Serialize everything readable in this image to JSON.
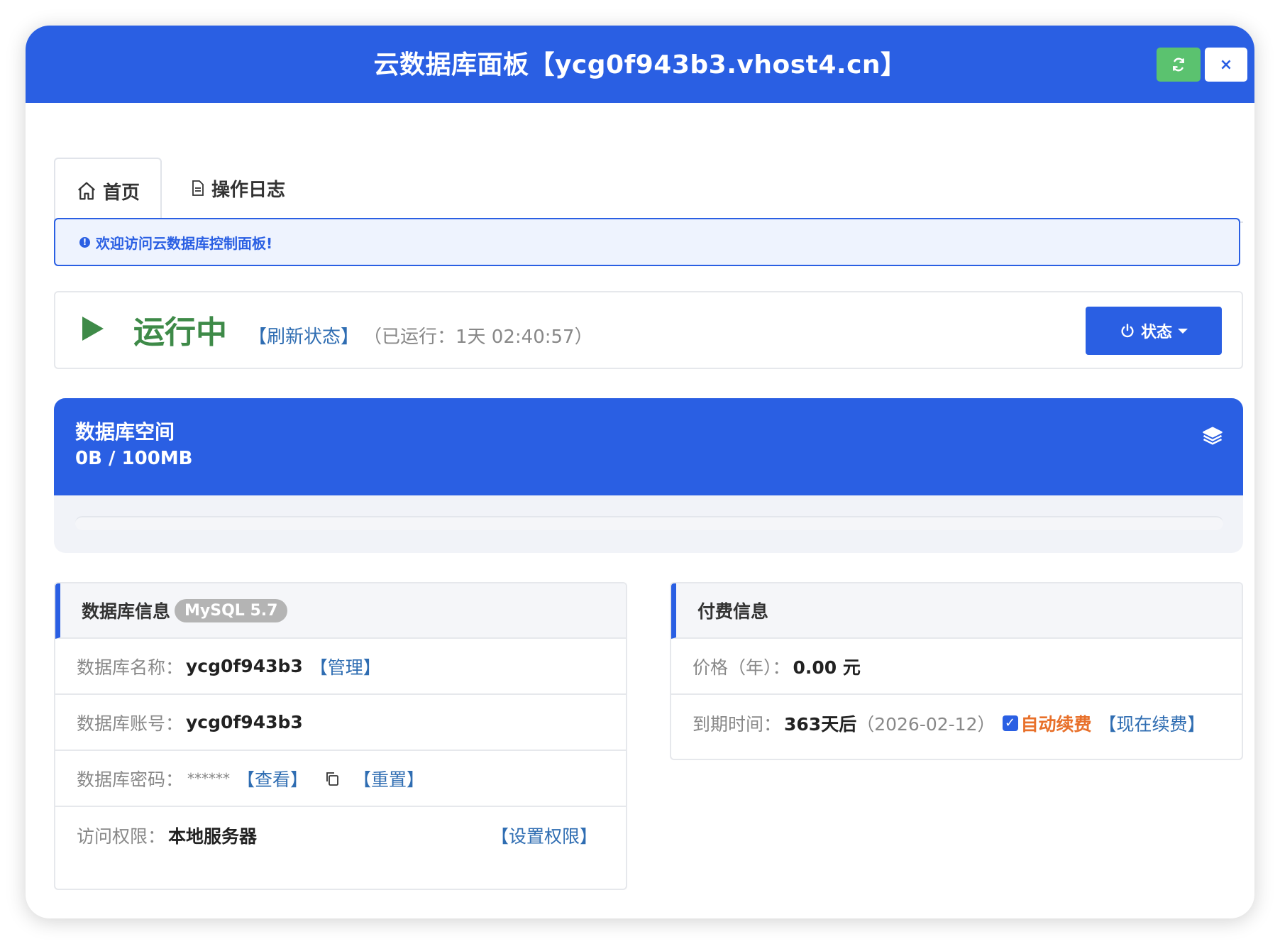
{
  "header": {
    "title": "云数据库面板【ycg0f943b3.vhost4.cn】",
    "refresh_icon": "refresh-icon",
    "close_label": "×"
  },
  "tabs": [
    {
      "label": "首页",
      "icon": "home-icon",
      "active": true
    },
    {
      "label": "操作日志",
      "icon": "file-icon",
      "active": false
    }
  ],
  "alert": {
    "text": "欢迎访问云数据库控制面板!",
    "icon": "info-icon"
  },
  "status": {
    "state": "运行中",
    "refresh_link": "【刷新状态】",
    "uptime": "（已运行：1天 02:40:57）",
    "button_label": "状态",
    "state_color": "#3e8a48"
  },
  "space": {
    "title": "数据库空间",
    "value": "0B / 100MB",
    "usage_fraction": 0
  },
  "db_info": {
    "title": "数据库信息",
    "badge": "MySQL 5.7",
    "rows": {
      "name_label": "数据库名称：",
      "name_value": "ycg0f943b3",
      "manage_link": "【管理】",
      "account_label": "数据库账号：",
      "account_value": "ycg0f943b3",
      "password_label": "数据库密码：",
      "password_value": "******",
      "view_link": "【查看】",
      "reset_link": "【重置】",
      "access_label": "访问权限：",
      "access_value": "本地服务器",
      "set_access_link": "【设置权限】"
    }
  },
  "payment": {
    "title": "付费信息",
    "price_label": "价格（年）：",
    "price_value": "0.00 元",
    "expire_label": "到期时间：",
    "expire_value": "363天后",
    "expire_date": "（2026-02-12）",
    "auto_renew_checked": true,
    "auto_renew_label": "自动续费",
    "renew_link": "【现在续费】"
  },
  "colors": {
    "primary": "#2a5fe3",
    "success": "#5bc26f",
    "running": "#3e8a48",
    "link": "#2f6db2",
    "warning": "#e8702a"
  }
}
